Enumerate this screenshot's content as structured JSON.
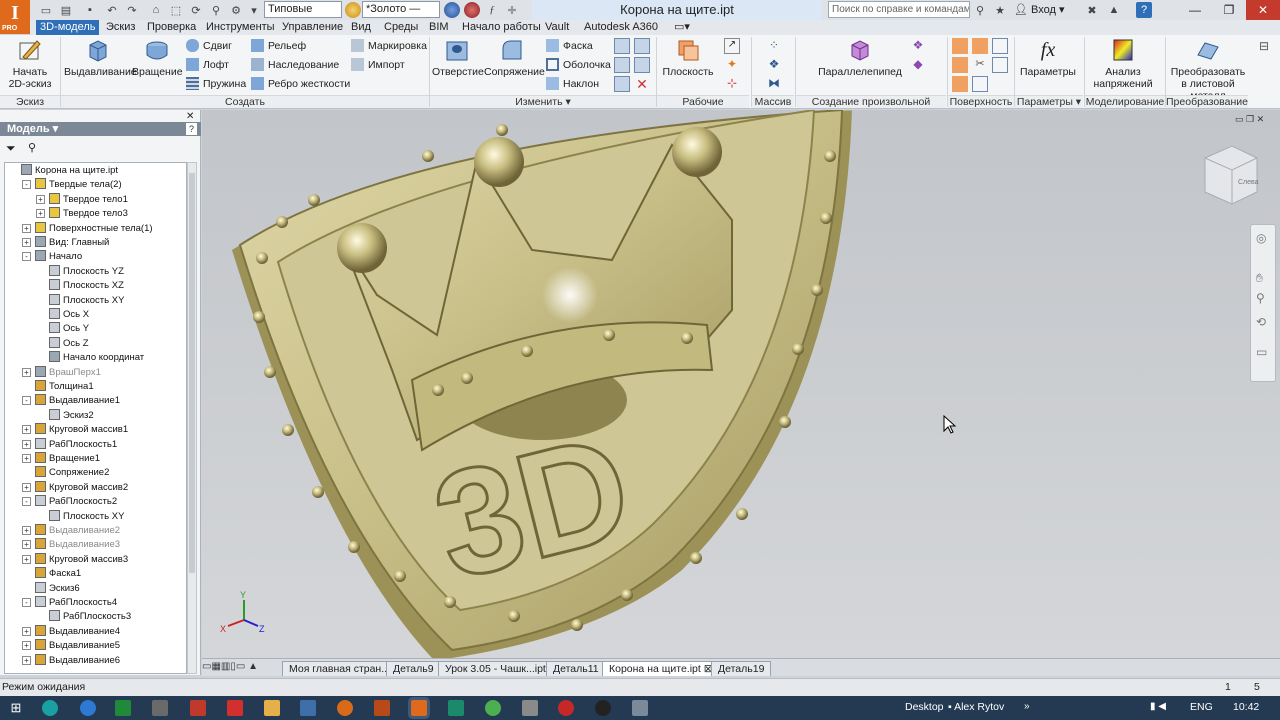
{
  "app": {
    "logo": "I",
    "logo_sub": "PRO",
    "title": "Корона на щите.ipt"
  },
  "quick_access": {
    "appearance_combo": "Типовые",
    "material_combo": "*Золото —",
    "search_placeholder": "Поиск по справке и командам...",
    "login": "Вход"
  },
  "tabs": [
    "3D-модель",
    "Эскиз",
    "Проверка",
    "Инструменты",
    "Управление",
    "Вид",
    "Среды",
    "BIM",
    "Начало работы",
    "Vault",
    "Autodesk A360"
  ],
  "ribbon": {
    "sketch": {
      "start_label": "Начать 2D-эскиз",
      "panel": "Эскиз"
    },
    "create": {
      "extrude": "Выдавливание",
      "revolve": "Вращение",
      "sweep": "Сдвиг",
      "loft": "Лофт",
      "coil": "Пружина",
      "emboss": "Рельеф",
      "derive": "Наследование",
      "rib": "Ребро жесткости",
      "mark": "Маркировка",
      "import": "Импорт",
      "panel": "Создать"
    },
    "modify": {
      "hole": "Отверстие",
      "fillet": "Сопряжение",
      "chamfer": "Фаска",
      "shell": "Оболочка",
      "draft": "Наклон",
      "panel": "Изменить"
    },
    "work": {
      "plane": "Плоскость",
      "panel": "Рабочие элементы"
    },
    "pattern": {
      "panel": "Массив"
    },
    "freeform": {
      "box": "Параллелепипед",
      "panel": "Создание произвольной формы"
    },
    "surface": {
      "panel": "Поверхность"
    },
    "params": {
      "label": "Параметры",
      "panel": "Параметры"
    },
    "sim": {
      "label": "Анализ напряжений",
      "panel": "Моделирование"
    },
    "convert": {
      "label": "Преобразовать в листовой металл",
      "panel": "Преобразование"
    }
  },
  "browser": {
    "title": "Модель",
    "nodes": [
      {
        "label": "Корона на щите.ipt",
        "level": 0,
        "exp": ""
      },
      {
        "label": "Твердые тела(2)",
        "level": 1,
        "exp": "-"
      },
      {
        "label": "Твердое тело1",
        "level": 2,
        "exp": "+"
      },
      {
        "label": "Твердое тело3",
        "level": 2,
        "exp": "+"
      },
      {
        "label": "Поверхностные тела(1)",
        "level": 1,
        "exp": "+"
      },
      {
        "label": "Вид: Главный",
        "level": 1,
        "exp": "+"
      },
      {
        "label": "Начало",
        "level": 1,
        "exp": "-"
      },
      {
        "label": "Плоскость YZ",
        "level": 2,
        "exp": ""
      },
      {
        "label": "Плоскость XZ",
        "level": 2,
        "exp": ""
      },
      {
        "label": "Плоскость XY",
        "level": 2,
        "exp": ""
      },
      {
        "label": "Ось X",
        "level": 2,
        "exp": ""
      },
      {
        "label": "Ось Y",
        "level": 2,
        "exp": ""
      },
      {
        "label": "Ось Z",
        "level": 2,
        "exp": ""
      },
      {
        "label": "Начало координат",
        "level": 2,
        "exp": ""
      },
      {
        "label": "ВрашПерх1",
        "level": 1,
        "exp": "+",
        "dim": true
      },
      {
        "label": "Толщина1",
        "level": 1,
        "exp": ""
      },
      {
        "label": "Выдавливание1",
        "level": 1,
        "exp": "-"
      },
      {
        "label": "Эскиз2",
        "level": 2,
        "exp": ""
      },
      {
        "label": "Круговой массив1",
        "level": 1,
        "exp": "+"
      },
      {
        "label": "РабПлоскость1",
        "level": 1,
        "exp": "+"
      },
      {
        "label": "Вращение1",
        "level": 1,
        "exp": "+"
      },
      {
        "label": "Сопряжение2",
        "level": 1,
        "exp": ""
      },
      {
        "label": "Круговой массив2",
        "level": 1,
        "exp": "+"
      },
      {
        "label": "РабПлоскость2",
        "level": 1,
        "exp": "-"
      },
      {
        "label": "Плоскость XY",
        "level": 2,
        "exp": ""
      },
      {
        "label": "Выдавливание2",
        "level": 1,
        "exp": "+",
        "dim": true
      },
      {
        "label": "Выдавливание3",
        "level": 1,
        "exp": "+",
        "dim": true
      },
      {
        "label": "Круговой массив3",
        "level": 1,
        "exp": "+"
      },
      {
        "label": "Фаска1",
        "level": 1,
        "exp": ""
      },
      {
        "label": "Эскиз6",
        "level": 1,
        "exp": ""
      },
      {
        "label": "РабПлоскость4",
        "level": 1,
        "exp": "-"
      },
      {
        "label": "РабПлоскость3",
        "level": 2,
        "exp": ""
      },
      {
        "label": "Выдавливание4",
        "level": 1,
        "exp": "+"
      },
      {
        "label": "Выдавливание5",
        "level": 1,
        "exp": "+"
      },
      {
        "label": "Выдавливание6",
        "level": 1,
        "exp": "+"
      }
    ]
  },
  "viewport": {
    "emblem_text": "3D",
    "triad": {
      "x": "X",
      "y": "Y",
      "z": "Z"
    },
    "viewcube_face": "Слева"
  },
  "doc_tabs": [
    "Моя главная стран...",
    "Деталь9",
    "Урок 3.05 - Чашк...ipt",
    "Деталь11",
    "Корона на щите.ipt",
    "Деталь19"
  ],
  "status": {
    "text": "Режим ожидания",
    "count1": "1",
    "count2": "5"
  },
  "taskbar": {
    "desktop": "Desktop",
    "user": "Alex Rytov",
    "lang": "ENG",
    "time": "10:42"
  },
  "colors": {
    "accent": "#2f6fb8",
    "gold": "#c9c08a",
    "taskbar": "#243a52"
  }
}
